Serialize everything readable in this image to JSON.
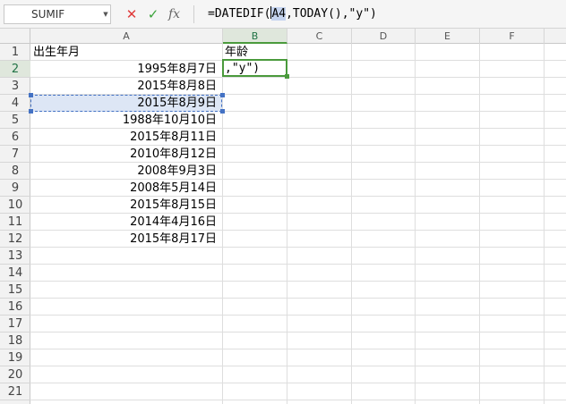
{
  "formula_bar": {
    "name_box": "SUMIF",
    "name_dropdown": "▼",
    "cancel": "✕",
    "confirm": "✓",
    "fx": "fx",
    "formula_before": "=DATEDIF(",
    "formula_ref": "A4",
    "formula_after": ",TODAY(),\"y\")"
  },
  "columns": [
    "A",
    "B",
    "C",
    "D",
    "E",
    "F"
  ],
  "rows": [
    "1",
    "2",
    "3",
    "4",
    "5",
    "6",
    "7",
    "8",
    "9",
    "10",
    "11",
    "12",
    "13",
    "14",
    "15",
    "16",
    "17",
    "18",
    "19",
    "20",
    "21"
  ],
  "cells": {
    "A1": "出生年月",
    "B1": "年龄",
    "A2": "1995年8月7日",
    "A3": "2015年8月8日",
    "A4": "2015年8月9日",
    "A5": "1988年10月10日",
    "A6": "2015年8月11日",
    "A7": "2010年8月12日",
    "A8": "2008年9月3日",
    "A9": "2008年5月14日",
    "A10": "2015年8月15日",
    "A11": "2014年4月16日",
    "A12": "2015年8月17日",
    "B2": ",\"y\")"
  }
}
